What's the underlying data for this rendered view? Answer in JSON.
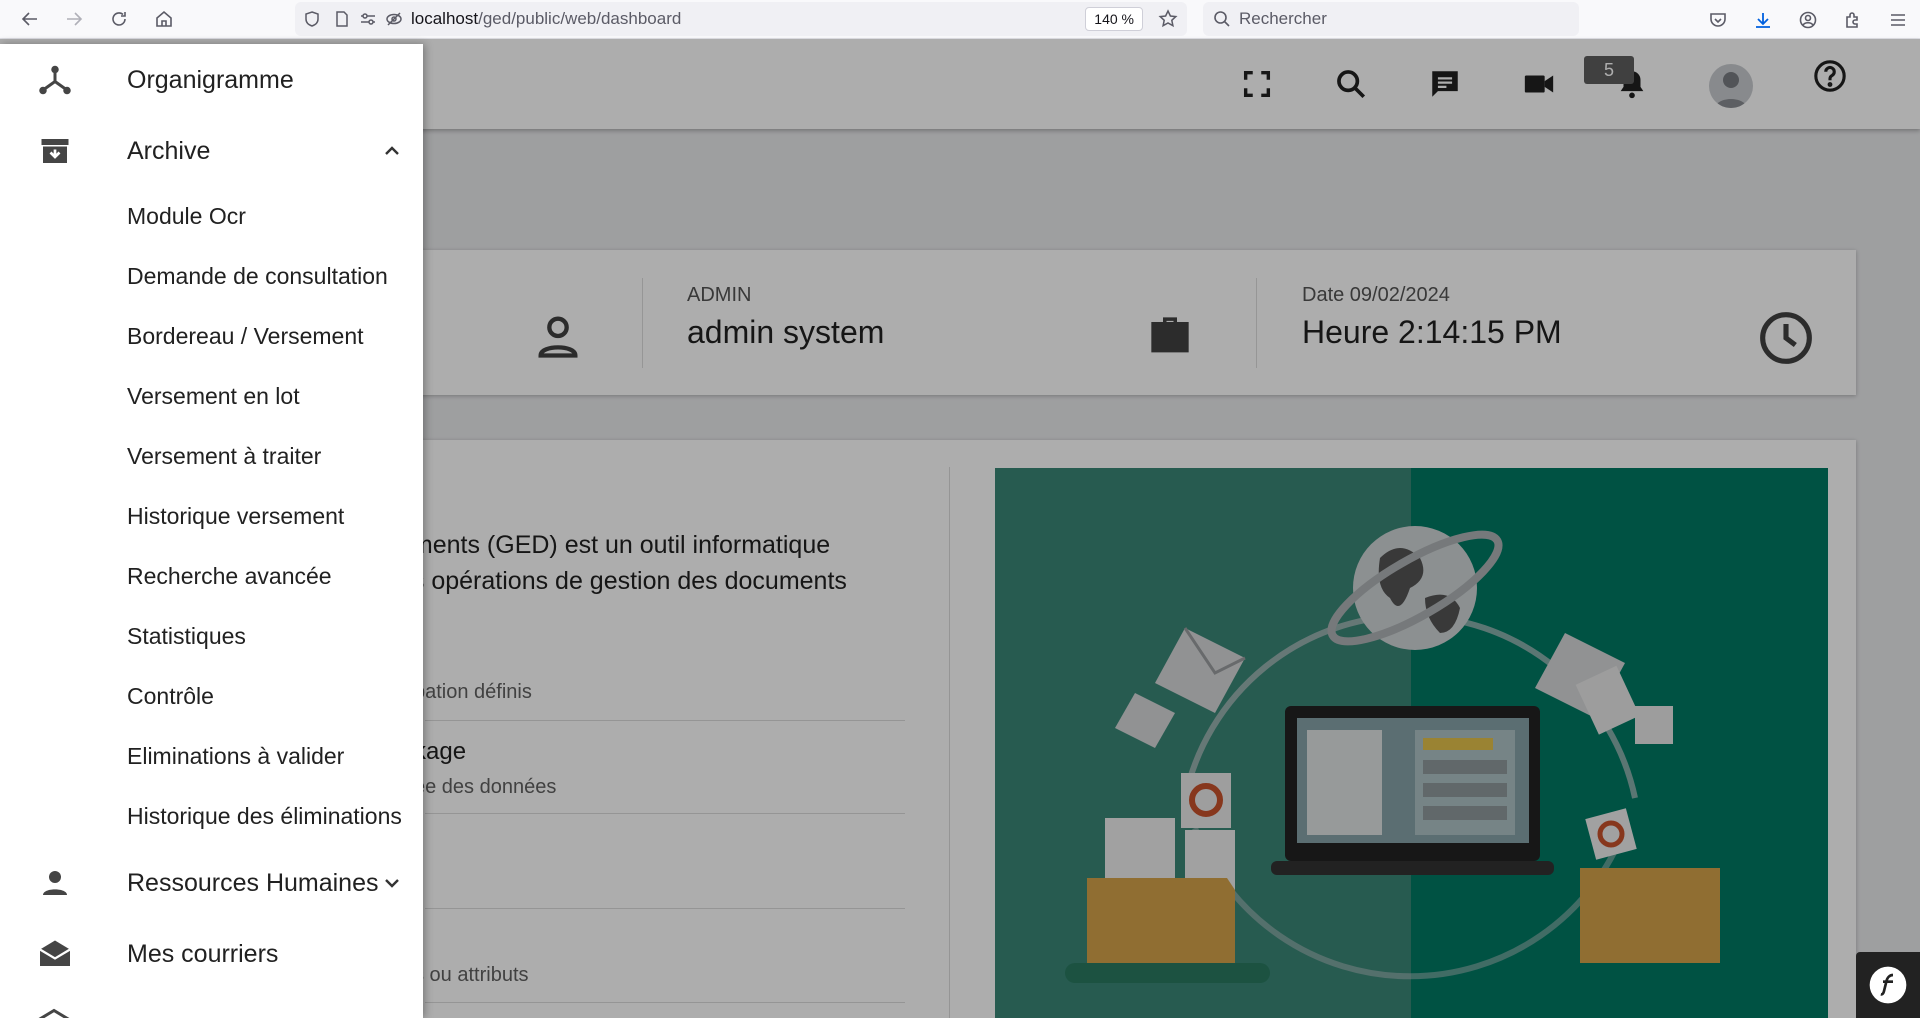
{
  "browser": {
    "url_host": "localhost",
    "url_path": "/ged/public/web/dashboard",
    "zoom": "140 %",
    "search_placeholder": "Rechercher"
  },
  "header": {
    "notification_count": "5"
  },
  "info_card": {
    "role_label": "ADMIN",
    "user_name": "admin system",
    "date_label": "Date 09/02/2024",
    "time_value": "Heure 2:14:15 PM"
  },
  "main": {
    "intro_line1": "uments (GED) est un outil informatique",
    "intro_line2": "es opérations de gestion des documents",
    "list": [
      {
        "sub": "pation définis"
      },
      {
        "title": "kage",
        "sub": "ee des données"
      },
      {
        "sub": "s ou attributs"
      }
    ]
  },
  "sidebar": {
    "organigramme": "Organigramme",
    "archive": "Archive",
    "archive_items": [
      "Module Ocr",
      "Demande de consultation",
      "Bordereau / Versement",
      "Versement en lot",
      "Versement à traiter",
      "Historique versement",
      "Recherche avancée",
      "Statistiques",
      "Contrôle",
      "Eliminations à valider",
      "Historique des éliminations"
    ],
    "rh": "Ressources Humaines",
    "courriers": "Mes courriers"
  },
  "colors": {
    "illustration_left": "#3a8677",
    "illustration_right": "#007a64",
    "folder": "#d4a24a"
  }
}
